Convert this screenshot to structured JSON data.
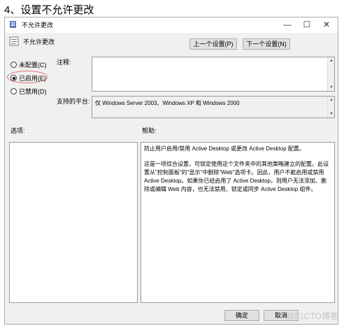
{
  "step_title": "4、设置不允许更改",
  "window": {
    "title": "不允许更改",
    "minimize_glyph": "—",
    "maximize_glyph": "☐",
    "close_glyph": "✕"
  },
  "header": {
    "policy_name": "不允许更改",
    "prev_button": "上一个设置(P)",
    "next_button": "下一个设置(N)"
  },
  "state": {
    "options": [
      {
        "label": "未配置(C)",
        "selected": false
      },
      {
        "label": "已启用(E)",
        "selected": true
      },
      {
        "label": "已禁用(D)",
        "selected": false
      }
    ]
  },
  "comment": {
    "label": "注释:",
    "value": ""
  },
  "platform": {
    "label": "支持的平台:",
    "value": "仅 Windows Server 2003、Windows XP 和 Windows 2000"
  },
  "options_section": {
    "label": "选项:"
  },
  "help_section": {
    "label": "帮助:",
    "paragraph1": "防止用户启用/禁用 Active Desktop 或更改 Active Desktop 配置。",
    "paragraph2": "这是一项综合设置，可锁定使用这个文件夹中的其他策略建立的配置。此设置从\"控制面板\"的\"显示\"中删除\"Web\"选项卡。因此，用户不能启用或禁用 Active Desktop。如果你已经启用了 Active Desktop，则用户无法添加、删除或编辑 Web 内容，也无法禁用、锁定或同步 Active Desktop 组件。"
  },
  "footer": {
    "ok_button": "确定",
    "cancel_button": "取消"
  },
  "watermark": "@51CTO博客",
  "colors": {
    "dialog_bg": "#f0f0f0",
    "highlight": "#e07070"
  }
}
